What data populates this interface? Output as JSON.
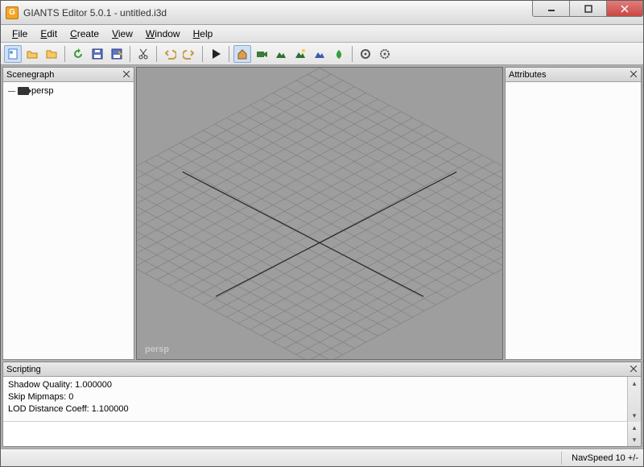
{
  "title": "GIANTS Editor 5.0.1 - untitled.i3d",
  "menu": [
    "File",
    "Edit",
    "Create",
    "View",
    "Window",
    "Help"
  ],
  "panels": {
    "scenegraph": {
      "title": "Scenegraph"
    },
    "attributes": {
      "title": "Attributes"
    },
    "scripting": {
      "title": "Scripting"
    }
  },
  "tree": {
    "items": [
      {
        "label": "persp",
        "icon": "camera"
      }
    ]
  },
  "viewport": {
    "label": "persp"
  },
  "scripting_output": {
    "line1": "Shadow Quality: 1.000000",
    "line2": "Skip Mipmaps: 0",
    "line3": "LOD Distance Coeff: 1.100000"
  },
  "status": {
    "navspeed": "NavSpeed 10 +/-"
  }
}
